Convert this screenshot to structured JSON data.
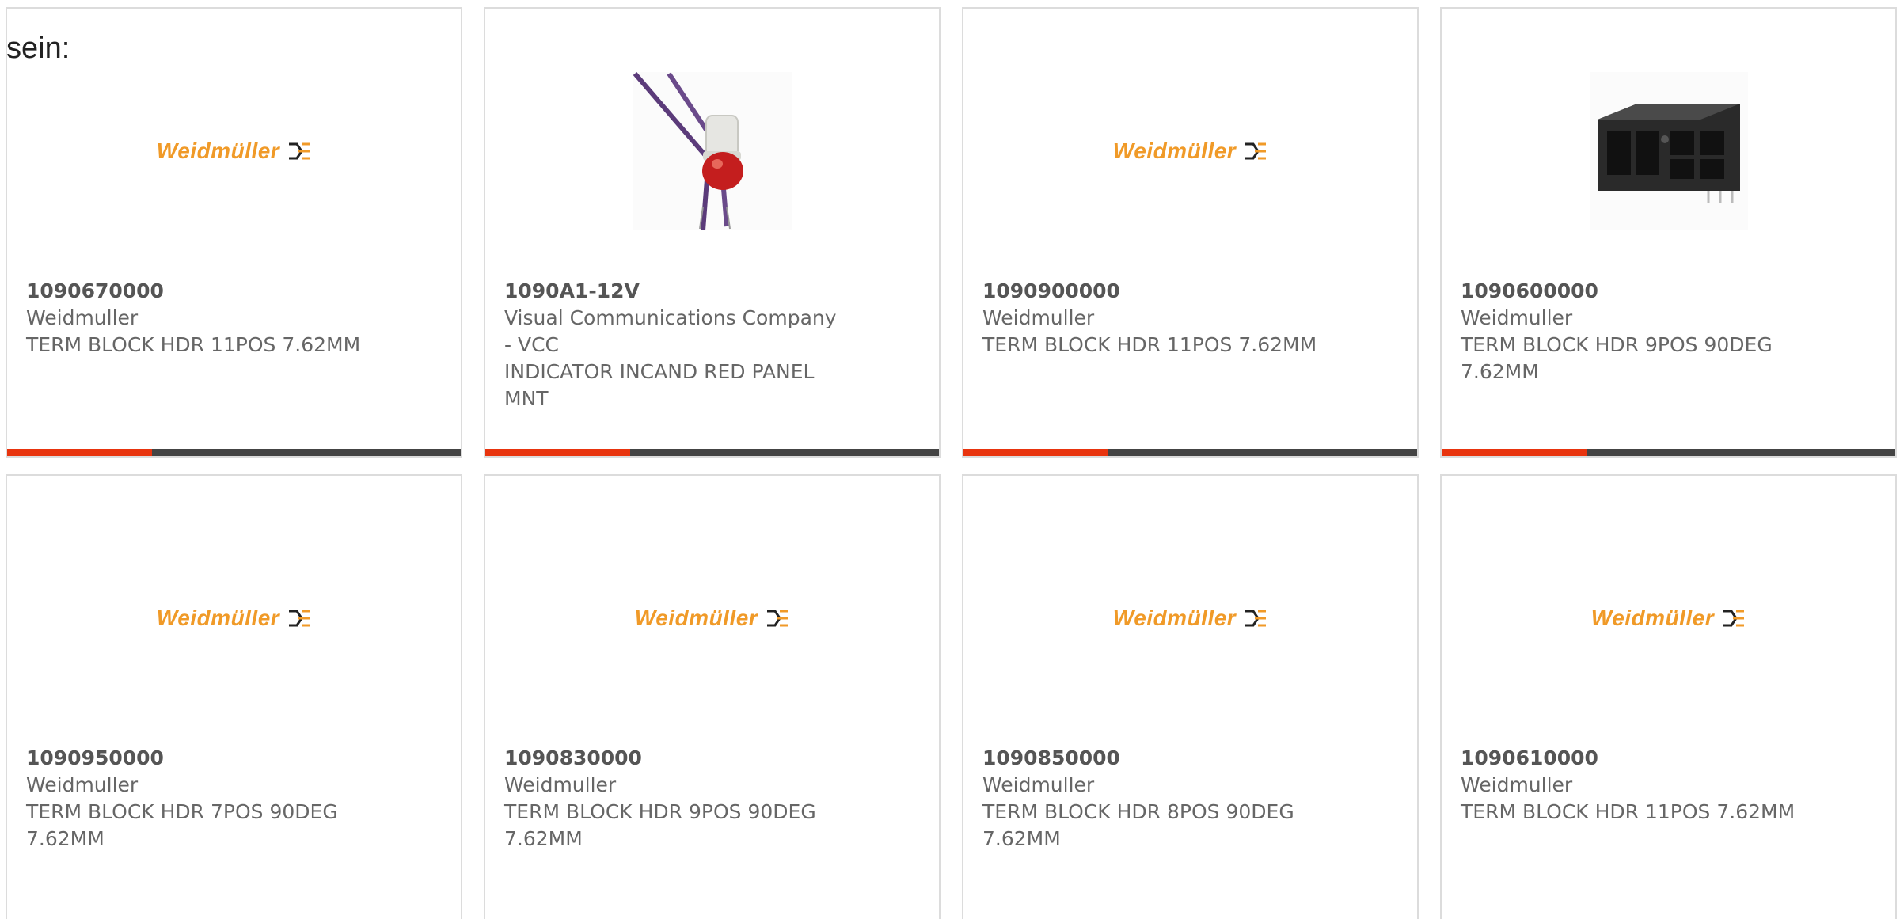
{
  "heading": "sein:",
  "colors": {
    "accent": "#e8340e",
    "bar_track": "#444444",
    "logo_orange": "#f09a28"
  },
  "cards": [
    {
      "part": "1090670000",
      "maker": "Weidmuller",
      "desc_lines": [
        "TERM BLOCK HDR 11POS 7.62MM"
      ],
      "image": "weidmuller-logo",
      "logo_text": "Weidmüller"
    },
    {
      "part": "1090A1-12V",
      "maker_lines": [
        "Visual Communications Company",
        "- VCC"
      ],
      "desc_lines": [
        "INDICATOR INCAND RED PANEL",
        "MNT"
      ],
      "image": "indicator-lamp-photo"
    },
    {
      "part": "1090900000",
      "maker": "Weidmuller",
      "desc_lines": [
        "TERM BLOCK HDR 11POS 7.62MM"
      ],
      "image": "weidmuller-logo",
      "logo_text": "Weidmüller"
    },
    {
      "part": "1090600000",
      "maker": "Weidmuller",
      "desc_lines": [
        "TERM BLOCK HDR 9POS 90DEG",
        "7.62MM"
      ],
      "image": "terminal-block-photo"
    },
    {
      "part": "1090950000",
      "maker": "Weidmuller",
      "desc_lines": [
        "TERM BLOCK HDR 7POS 90DEG",
        "7.62MM"
      ],
      "image": "weidmuller-logo",
      "logo_text": "Weidmüller"
    },
    {
      "part": "1090830000",
      "maker": "Weidmuller",
      "desc_lines": [
        "TERM BLOCK HDR 9POS 90DEG",
        "7.62MM"
      ],
      "image": "weidmuller-logo",
      "logo_text": "Weidmüller"
    },
    {
      "part": "1090850000",
      "maker": "Weidmuller",
      "desc_lines": [
        "TERM BLOCK HDR 8POS 90DEG",
        "7.62MM"
      ],
      "image": "weidmuller-logo",
      "logo_text": "Weidmüller"
    },
    {
      "part": "1090610000",
      "maker": "Weidmuller",
      "desc_lines": [
        "TERM BLOCK HDR 11POS 7.62MM"
      ],
      "image": "weidmuller-logo",
      "logo_text": "Weidmüller"
    }
  ],
  "progress_fraction": 0.32
}
